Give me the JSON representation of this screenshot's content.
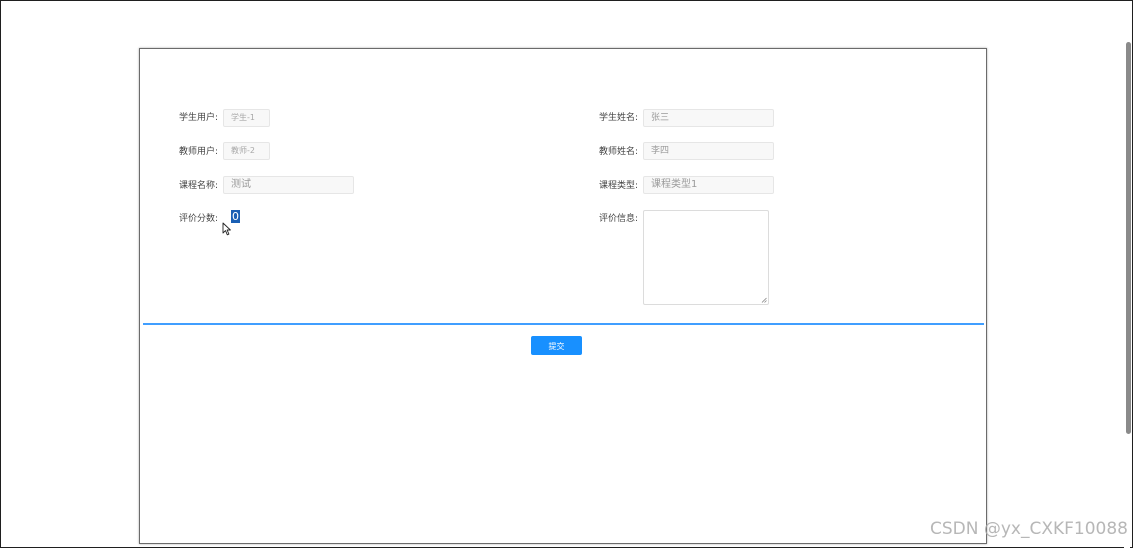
{
  "form": {
    "student_user": {
      "label": "学生用户:",
      "value": "学生-1"
    },
    "student_name": {
      "label": "学生姓名:",
      "value": "张三"
    },
    "teacher_user": {
      "label": "教师用户:",
      "value": "教师-2"
    },
    "teacher_name": {
      "label": "教师姓名:",
      "value": "李四"
    },
    "course_name": {
      "label": "课程名称:",
      "value": "测试"
    },
    "course_type": {
      "label": "课程类型:",
      "value": "课程类型1"
    },
    "rating_score": {
      "label": "评价分数:",
      "value": "0"
    },
    "rating_info": {
      "label": "评价信息:",
      "value": ""
    }
  },
  "actions": {
    "submit_label": "提交"
  },
  "watermark": "CSDN @yx_CXKF10088",
  "colors": {
    "accent": "#409eff",
    "button": "#1890ff",
    "selection": "#1a5fb4"
  },
  "icons": {
    "cursor": "mouse-pointer-icon",
    "resize": "resize-handle-icon"
  }
}
